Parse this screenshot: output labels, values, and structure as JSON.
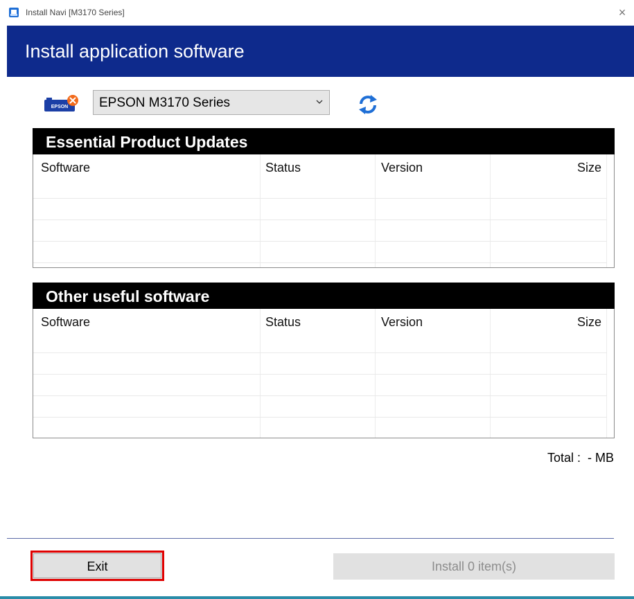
{
  "window": {
    "title": "Install Navi [M3170 Series]",
    "close_glyph": "×"
  },
  "banner": {
    "title": "Install application software"
  },
  "printer": {
    "icon_label": "EPSON",
    "selected": "EPSON M3170 Series",
    "status_icon": "error-badge-icon",
    "refresh_icon": "refresh-icon"
  },
  "essential": {
    "title": "Essential Product Updates",
    "columns": [
      "Software",
      "Status",
      "Version",
      "Size"
    ],
    "rows": []
  },
  "other": {
    "title": "Other useful software",
    "columns": [
      "Software",
      "Status",
      "Version",
      "Size"
    ],
    "rows": []
  },
  "total": {
    "label": "Total :",
    "value": "- MB"
  },
  "buttons": {
    "exit": "Exit",
    "install": "Install 0 item(s)"
  },
  "colors": {
    "banner": "#0e2a8c",
    "highlight": "#e00000",
    "panel_header": "#000000",
    "refresh": "#1f6fd6"
  }
}
